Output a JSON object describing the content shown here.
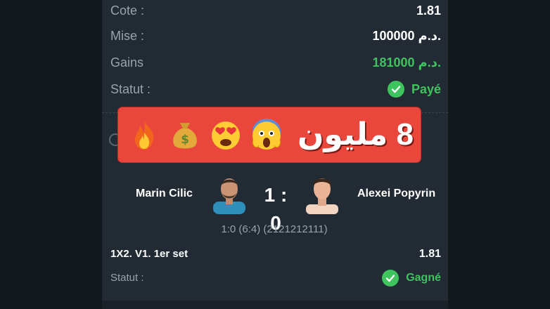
{
  "bet": {
    "rows": [
      {
        "label": "Cote :",
        "value": "1.81"
      },
      {
        "label": "Mise :",
        "value": "100000 د.م."
      },
      {
        "label": "Gains",
        "value": "181000 د.م."
      },
      {
        "label": "Statut :",
        "value": "Payé"
      }
    ]
  },
  "banner": {
    "text": "8 مليون",
    "emojis": [
      "fire-emoji",
      "money-bag-emoji",
      "heart-eyes-emoji",
      "screaming-face-emoji"
    ]
  },
  "match": {
    "player1": "Marin Cilic",
    "player2": "Alexei Popyrin",
    "score": "1 : 0",
    "detail": "1:0 (6:4) (2121212111)"
  },
  "market": {
    "label": "1X2. V1. 1er set",
    "odds": "1.81",
    "status_label": "Statut :",
    "status_value": "Gagné"
  },
  "colors": {
    "panel": "#222b33",
    "background": "#13181c",
    "accent_green": "#3ec35f",
    "banner_red": "#e9473c"
  }
}
